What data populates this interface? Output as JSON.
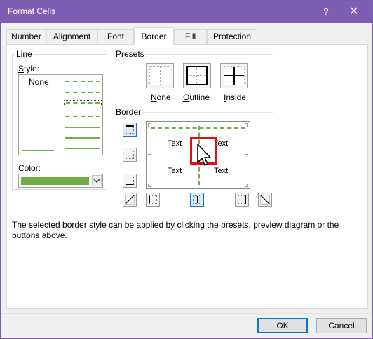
{
  "window": {
    "title": "Format Cells",
    "help_glyph": "?",
    "close_glyph": "✕"
  },
  "tabs": [
    {
      "label": "Number"
    },
    {
      "label": "Alignment"
    },
    {
      "label": "Font"
    },
    {
      "label": "Border",
      "active": true
    },
    {
      "label": "Fill"
    },
    {
      "label": "Protection"
    }
  ],
  "line": {
    "group_label": "Line",
    "style_label_prefix": "S",
    "style_label_rest": "tyle:",
    "style_none": "None",
    "color_label_prefix": "C",
    "color_label_rest": "olor:",
    "selected_color": "#70ad47"
  },
  "presets": {
    "group_label": "Presets",
    "items": [
      {
        "label_prefix": "N",
        "label_rest": "one"
      },
      {
        "label_prefix": "O",
        "label_rest": "utline"
      },
      {
        "label_prefix": "I",
        "label_rest": "nside"
      }
    ]
  },
  "border": {
    "group_label": "Border",
    "preview_texts": [
      "Text",
      "Text",
      "Text",
      "Text"
    ]
  },
  "description": "The selected border style can be applied by clicking the presets, preview diagram or the buttons above.",
  "buttons": {
    "ok": "OK",
    "cancel": "Cancel"
  },
  "colors": {
    "titlebar": "#7e5eb4",
    "accent_green": "#70ad47",
    "highlight": "#e01010"
  }
}
